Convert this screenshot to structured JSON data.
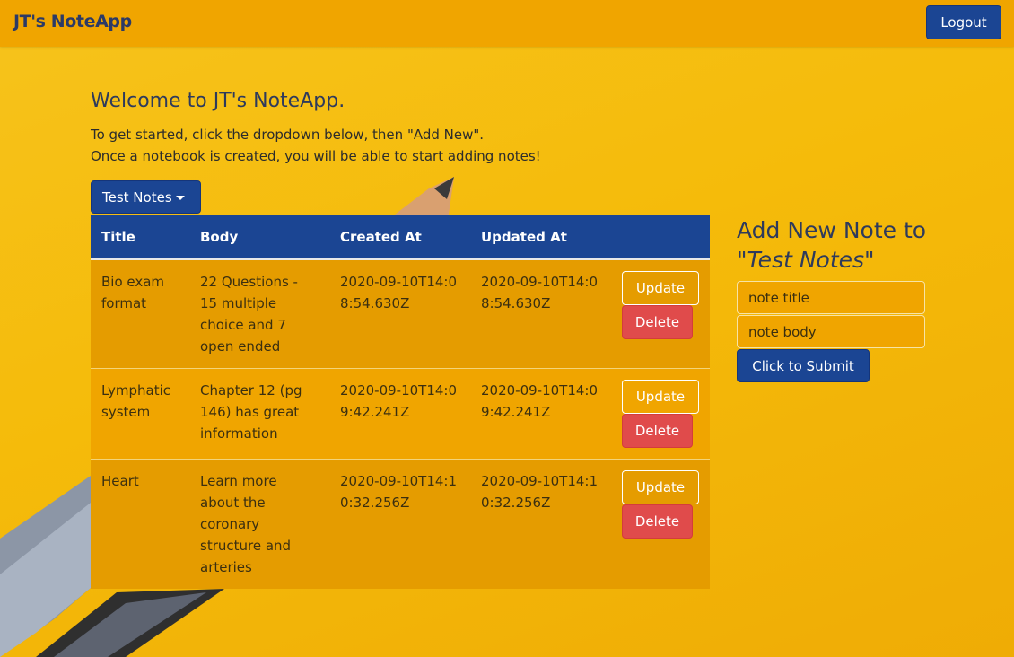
{
  "navbar": {
    "brand": "JT's NoteApp",
    "logout_label": "Logout"
  },
  "welcome": {
    "title": "Welcome to JT's NoteApp.",
    "line1": "To get started, click the dropdown below, then \"Add New\".",
    "line2": "Once a notebook is created, you will be able to start adding notes!"
  },
  "notebook_dropdown": {
    "selected": "Test Notes"
  },
  "table": {
    "headers": [
      "Title",
      "Body",
      "Created At",
      "Updated At"
    ],
    "update_label": "Update",
    "delete_label": "Delete",
    "rows": [
      {
        "title": "Bio exam format",
        "body": "22 Questions - 15 multiple choice and 7 open ended",
        "created": "2020-09-10T14:08:54.630Z",
        "updated": "2020-09-10T14:08:54.630Z"
      },
      {
        "title": "Lymphatic system",
        "body": "Chapter 12 (pg 146) has great information",
        "created": "2020-09-10T14:09:42.241Z",
        "updated": "2020-09-10T14:09:42.241Z"
      },
      {
        "title": "Heart",
        "body": "Learn more about the coronary structure and arteries",
        "created": "2020-09-10T14:10:32.256Z",
        "updated": "2020-09-10T14:10:32.256Z"
      }
    ]
  },
  "add_note": {
    "heading_prefix": "Add New Note to",
    "notebook_name": "\"Test Notes\"",
    "title_placeholder": "note title",
    "body_placeholder": "note body",
    "submit_label": "Click to Submit"
  },
  "colors": {
    "navbar": "#f0a500",
    "primary": "#1b4593",
    "danger": "#e04b4b",
    "background": "#f5bb0a"
  }
}
